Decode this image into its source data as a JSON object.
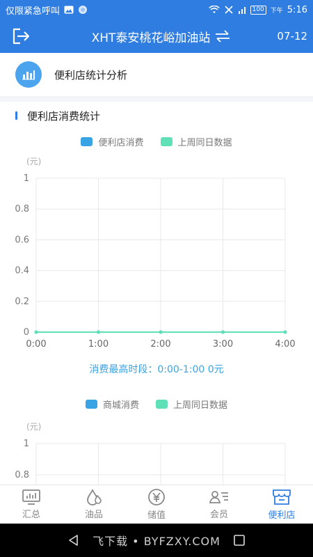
{
  "status_bar": {
    "carrier_text": "仅限紧急呼叫",
    "battery": "100",
    "afternoon_label": "下午",
    "time": "5:16"
  },
  "header": {
    "title": "XHT泰安桃花峪加油站",
    "date": "07-12"
  },
  "section": {
    "title": "便利店统计分析"
  },
  "subsection": {
    "title": "便利店消费统计"
  },
  "chart1": {
    "legend": [
      "便利店消费",
      "上周同日数据"
    ],
    "unit": "(元)",
    "peak_text": "消费最高时段：0:00-1:00   0元"
  },
  "chart2": {
    "legend": [
      "商城消费",
      "上周同日数据"
    ],
    "unit": "(元)"
  },
  "colors": {
    "primary": "#2f7de1",
    "series_blue": "#3aa3e3",
    "series_green": "#5fe0b6"
  },
  "chart_data": [
    {
      "type": "line",
      "x": [
        "0:00",
        "1:00",
        "2:00",
        "3:00",
        "4:00"
      ],
      "series": [
        {
          "name": "便利店消费",
          "values": [
            0,
            0,
            0,
            0,
            0
          ]
        },
        {
          "name": "上周同日数据",
          "values": [
            0,
            0,
            0,
            0,
            0
          ]
        }
      ],
      "yticks": [
        "0",
        "0.2",
        "0.4",
        "0.6",
        "0.8",
        "1"
      ],
      "ylim": [
        0,
        1
      ],
      "ylabel": "(元)",
      "grid": true,
      "legend_placement": "top"
    },
    {
      "type": "line",
      "series": [
        {
          "name": "商城消费",
          "values": []
        },
        {
          "name": "上周同日数据",
          "values": []
        }
      ],
      "yticks": [
        "0.8",
        "1"
      ],
      "ylim": [
        0,
        1
      ],
      "ylabel": "(元)",
      "grid": true,
      "legend_placement": "top"
    }
  ],
  "bottom_nav": [
    {
      "label": "汇总",
      "icon": "monitor-icon"
    },
    {
      "label": "油品",
      "icon": "oil-drop-icon"
    },
    {
      "label": "储值",
      "icon": "yuan-icon"
    },
    {
      "label": "会员",
      "icon": "member-card-icon"
    },
    {
      "label": "便利店",
      "icon": "store-icon"
    }
  ],
  "system_nav": {
    "watermark": "飞下载 • BYFZXY.COM"
  }
}
